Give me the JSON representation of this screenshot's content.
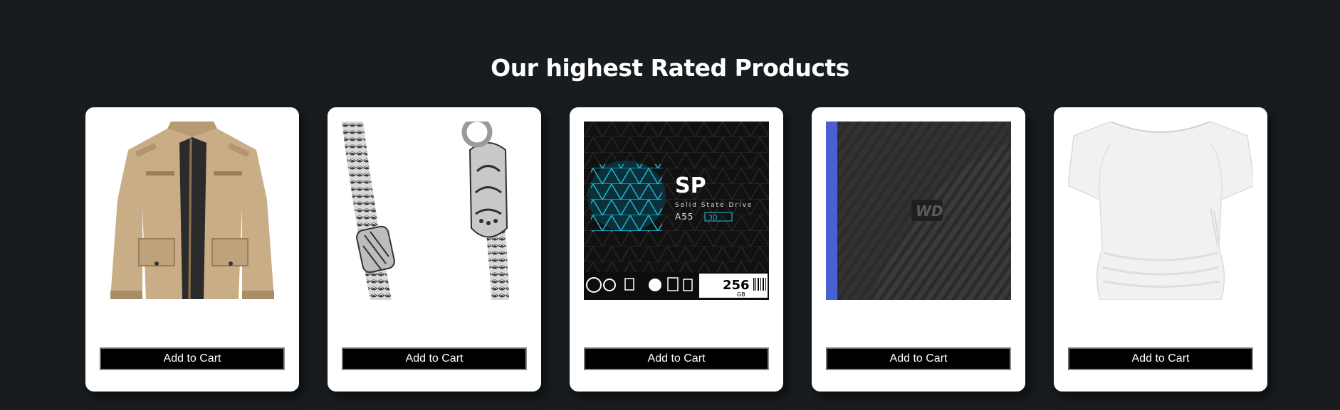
{
  "section": {
    "title": "Our highest Rated Products"
  },
  "products": [
    {
      "image": "khaki-jacket-image",
      "button_label": "Add to Cart"
    },
    {
      "image": "silver-chain-bracelet-image",
      "button_label": "Add to Cart"
    },
    {
      "image": "ssd-drive-image",
      "button_label": "Add to Cart",
      "image_text": {
        "brand": "SP",
        "line": "Solid State Drive",
        "model": "A55",
        "tag": "3D",
        "capacity": "256",
        "unit": "GB"
      }
    },
    {
      "image": "external-hard-drive-image",
      "button_label": "Add to Cart",
      "image_text": {
        "brand": "WD"
      }
    },
    {
      "image": "white-top-image",
      "button_label": "Add to Cart"
    }
  ],
  "colors": {
    "page_background": "#181c1f",
    "card_background": "#ffffff",
    "button_background": "#000000",
    "button_text": "#ffffff",
    "title_text": "#ffffff"
  }
}
